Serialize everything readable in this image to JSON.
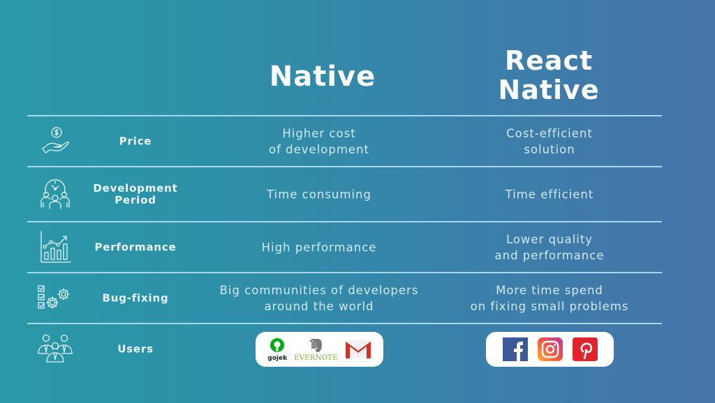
{
  "headers": {
    "native": "Native",
    "react_native": "React\nNative"
  },
  "rows": [
    {
      "icon": "hand-dollar-icon",
      "label": "Price",
      "native": "Higher cost\nof development",
      "react_native": "Cost-efficient\nsolution"
    },
    {
      "icon": "team-clock-icon",
      "label": "Development\nPeriod",
      "native": "Time consuming",
      "react_native": "Time efficient"
    },
    {
      "icon": "growth-chart-icon",
      "label": "Performance",
      "native": "High performance",
      "react_native": "Lower quality\nand performance"
    },
    {
      "icon": "checklist-gears-icon",
      "label": "Bug-fixing",
      "native": "Big communities of developers\naround the world",
      "react_native": "More time spend\non fixing small problems"
    },
    {
      "icon": "users-group-icon",
      "label": "Users",
      "native_logos": [
        {
          "name": "gojek",
          "text": "gojek",
          "color": "#00aa13"
        },
        {
          "name": "evernote",
          "text": "EVERNOTE",
          "color": "#7fb040"
        },
        {
          "name": "gmail",
          "text": "",
          "color": "#d93025"
        }
      ],
      "react_native_logos": [
        {
          "name": "facebook",
          "text": "f",
          "color": "#3b5998"
        },
        {
          "name": "instagram",
          "text": "",
          "color": "#e1306c"
        },
        {
          "name": "pinterest",
          "text": "P",
          "color": "#e60023"
        }
      ]
    }
  ],
  "colors": {
    "background_start": "#2a99a8",
    "background_end": "#4673a8",
    "rule": "#a8d8ec",
    "heading": "#ffffff",
    "cell_text": "#cfe9f2"
  }
}
